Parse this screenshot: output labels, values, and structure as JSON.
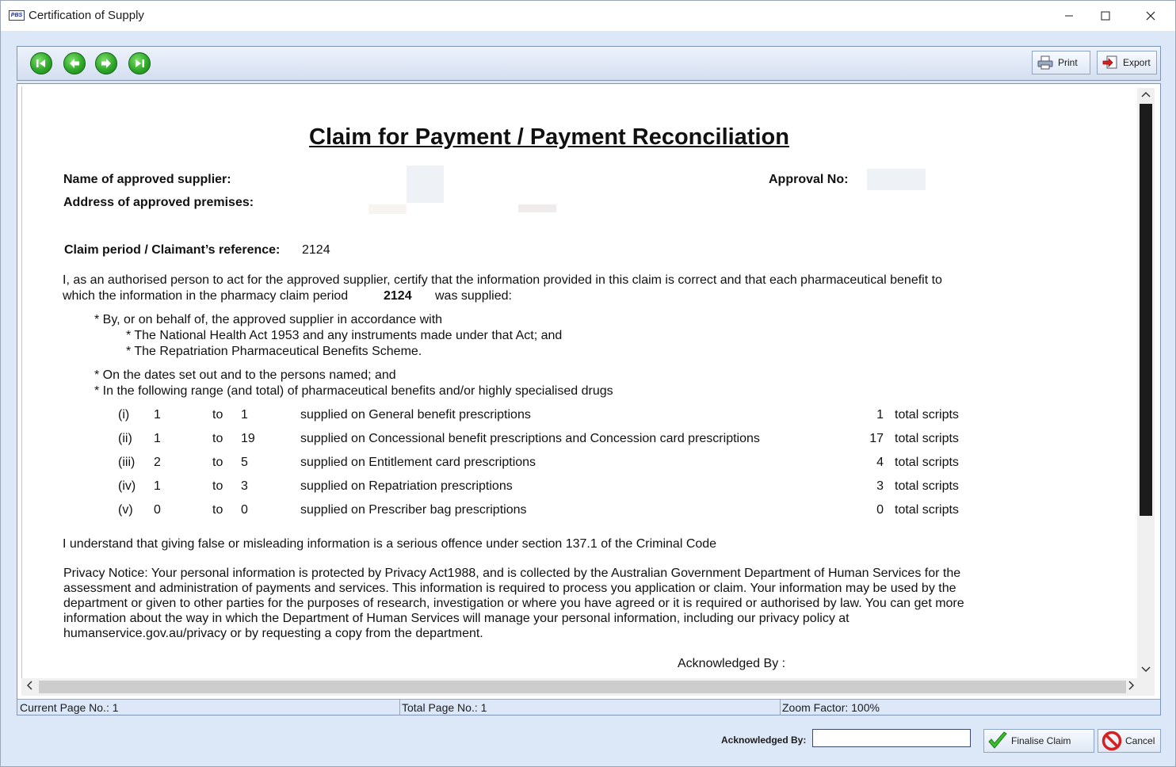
{
  "window": {
    "title": "Certification of Supply",
    "app_icon": "PBS",
    "controls": {
      "minimize": "—",
      "maximize": "☐",
      "close": "✕"
    }
  },
  "toolbar": {
    "nav": [
      "first-page-icon",
      "previous-page-icon",
      "next-page-icon",
      "last-page-icon"
    ],
    "print_label": "Print",
    "export_label": "Export"
  },
  "document": {
    "title": "Claim for Payment / Payment Reconciliation",
    "supplier_label": "Name of approved supplier:",
    "approval_label": "Approval No:",
    "address_label": "Address of approved premises:",
    "claim_period_label": "Claim period / Claimant’s reference:",
    "claim_period_value": "2124",
    "cert_line1": "I, as an authorised person to act for the approved supplier, certify that the information provided in this claim is correct and that each pharmaceutical benefit to",
    "cert_line2_a": "which the information in the pharmacy claim period",
    "cert_line2_period": "2124",
    "cert_line2_b": "was supplied:",
    "bullet1": "* By, or on behalf of, the approved supplier in accordance with",
    "bullet1a": "* The National Health Act 1953 and any instruments made under that Act; and",
    "bullet1b": "* The Repatriation Pharmaceutical Benefits Scheme.",
    "bullet2": "* On the dates set out and to the persons named; and",
    "bullet3": "* In the following range (and total) of pharmaceutical benefits and/or highly specialised drugs",
    "ranges": [
      {
        "num": "(i)",
        "from": "1",
        "to_word": "to",
        "to": "1",
        "desc": "supplied on General benefit prescriptions",
        "total": "1",
        "unit": "total scripts"
      },
      {
        "num": "(ii)",
        "from": "1",
        "to_word": "to",
        "to": "19",
        "desc": "supplied on Concessional benefit prescriptions and Concession card prescriptions",
        "total": "17",
        "unit": "total scripts"
      },
      {
        "num": "(iii)",
        "from": "2",
        "to_word": "to",
        "to": "5",
        "desc": "supplied on Entitlement card prescriptions",
        "total": "4",
        "unit": "total scripts"
      },
      {
        "num": "(iv)",
        "from": "1",
        "to_word": "to",
        "to": "3",
        "desc": "supplied on Repatriation prescriptions",
        "total": "3",
        "unit": "total scripts"
      },
      {
        "num": "(v)",
        "from": "0",
        "to_word": "to",
        "to": "0",
        "desc": "supplied on Prescriber bag prescriptions",
        "total": "0",
        "unit": "total scripts"
      }
    ],
    "offence_text": "I understand that giving false or misleading information is a serious offence under section 137.1 of the Criminal Code",
    "privacy_lines": [
      "Privacy Notice: Your personal information is protected by Privacy Act1988, and is collected by the Australian Government Department of Human Services for the",
      "assessment and administration of payments and services. This information is required to process you application or claim. Your information may be used by the",
      "department or given to other parties for the purposes of research, investigation or where you have agreed or it is required or authorised by law. You can get more",
      "information about the way in which the Department of Human Services will manage your personal information, including our privacy policy at",
      "humanservice.gov.au/privacy or by requesting a copy from the department."
    ],
    "acknowledged_label": "Acknowledged By :"
  },
  "status": {
    "current_page": "Current Page No.: 1",
    "total_page": "Total Page No.: 1",
    "zoom": "Zoom Factor: 100%"
  },
  "footer": {
    "acknowledged_label": "Acknowledged By:",
    "acknowledged_value": "",
    "finalise_label": "Finalise Claim",
    "cancel_label": "Cancel"
  },
  "colors": {
    "nav_green": "#2fa82a",
    "chrome_blue": "#dce7f7",
    "cancel_red": "#d42020"
  }
}
